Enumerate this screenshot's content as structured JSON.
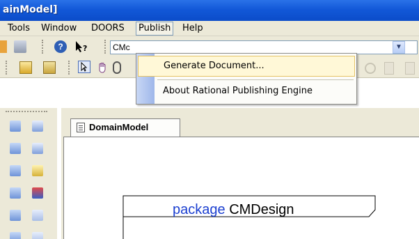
{
  "window": {
    "title": "ainModel]"
  },
  "menubar": {
    "items": [
      {
        "label": "Tools"
      },
      {
        "label": "Window"
      },
      {
        "label": "DOORS"
      },
      {
        "label": "Publish"
      },
      {
        "label": "Help"
      }
    ]
  },
  "toolbar": {
    "combo_value": "CMc"
  },
  "publish_menu": {
    "items": [
      {
        "label": "Generate Document..."
      },
      {
        "label": "About Rational Publishing Engine"
      }
    ]
  },
  "editor": {
    "tab_label": "DomainModel",
    "package_keyword": "package",
    "package_name": "CMDesign"
  },
  "colors": {
    "titlebar": "#1258d8",
    "menu_highlight": "#fff8d7",
    "keyword": "#1b3fd0"
  }
}
